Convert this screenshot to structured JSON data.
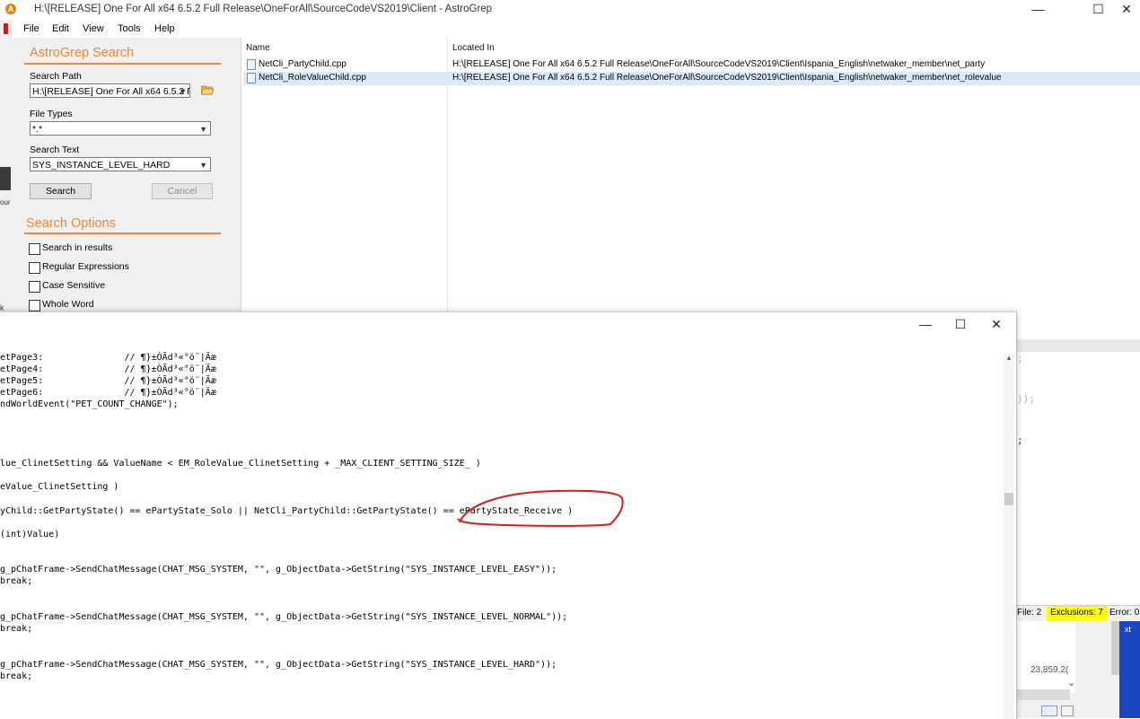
{
  "window": {
    "title": "H:\\[RELEASE] One For All x64 6.5.2 Full Release\\OneForAll\\SourceCodeVS2019\\Client - AstroGrep",
    "app_icon_glyph": "A",
    "controls": {
      "minimize": "—",
      "maximize": "☐",
      "close": "✕"
    }
  },
  "menu": [
    "File",
    "Edit",
    "View",
    "Tools",
    "Help"
  ],
  "left_edge": {
    "ou_text": "our",
    "k_text": "k"
  },
  "search_panel": {
    "heading": "AstroGrep Search",
    "search_path_label": "Search Path",
    "search_path_value": "H:\\[RELEASE] One For All x64 6.5.2 F",
    "file_types_label": "File Types",
    "file_types_value": "*.*",
    "search_text_label": "Search Text",
    "search_text_value": "SYS_INSTANCE_LEVEL_HARD",
    "search_button": "Search",
    "cancel_button": "Cancel",
    "options_heading": "Search Options",
    "options": [
      "Search in results",
      "Regular Expressions",
      "Case Sensitive",
      "Whole Word"
    ]
  },
  "results": {
    "columns": [
      "Name",
      "Located In"
    ],
    "rows": [
      {
        "name": "NetCli_PartyChild.cpp",
        "location": "H:\\[RELEASE] One For All x64 6.5.2 Full Release\\OneForAll\\SourceCodeVS2019\\Client\\Ispania_English\\netwaker_member\\net_party"
      },
      {
        "name": "NetCli_RoleValueChild.cpp",
        "location": "H:\\[RELEASE] One For All x64 6.5.2 Full Release\\OneForAll\\SourceCodeVS2019\\Client\\Ispania_English\\netwaker_member\\net_rolevalue"
      }
    ]
  },
  "background_code": [
    ";",
    "));",
    ";"
  ],
  "status_bar": {
    "files": "File: 2",
    "exclusions": "Exclusions: 7",
    "errors": "Error: 0"
  },
  "under_panel": {
    "number": "23,859,2(",
    "corner_text": "xt",
    "chevron": "⌄"
  },
  "editor": {
    "controls": {
      "minimize": "—",
      "maximize": "☐",
      "close": "✕"
    },
    "code_lines": [
      "etPage3:               // ¶}±ÒÃd³«°ö¨|Äæ",
      "etPage4:               // ¶}±ÒÃd³«°ö¨|Äæ",
      "etPage5:               // ¶}±ÒÃd³«°ö¨|Äæ",
      "etPage6:               // ¶}±ÒÃd³«°ö¨|Äæ",
      "ndWorldEvent(\"PET_COUNT_CHANGE\");",
      "lue_ClinetSetting && ValueName < EM_RoleValue_ClinetSetting + _MAX_CLIENT_SETTING_SIZE_ )",
      "eValue_ClinetSetting )",
      "yChild::GetPartyState() == ePartyState_Solo || NetCli_PartyChild::GetPartyState() == ePartyState_Receive )",
      "(int)Value)",
      "g_pChatFrame->SendChatMessage(CHAT_MSG_SYSTEM, \"\", g_ObjectData->GetString(\"SYS_INSTANCE_LEVEL_EASY\"));",
      "break;",
      "g_pChatFrame->SendChatMessage(CHAT_MSG_SYSTEM, \"\", g_ObjectData->GetString(\"SYS_INSTANCE_LEVEL_NORMAL\"));",
      "break;",
      "g_pChatFrame->SendChatMessage(CHAT_MSG_SYSTEM, \"\", g_ObjectData->GetString(\"SYS_INSTANCE_LEVEL_HARD\"));",
      "break;"
    ],
    "annotation_color": "#d81b1b"
  },
  "colors": {
    "accent": "#e8893a",
    "selection": "#dbe9f9",
    "exclusions_bg": "#ffff00"
  }
}
